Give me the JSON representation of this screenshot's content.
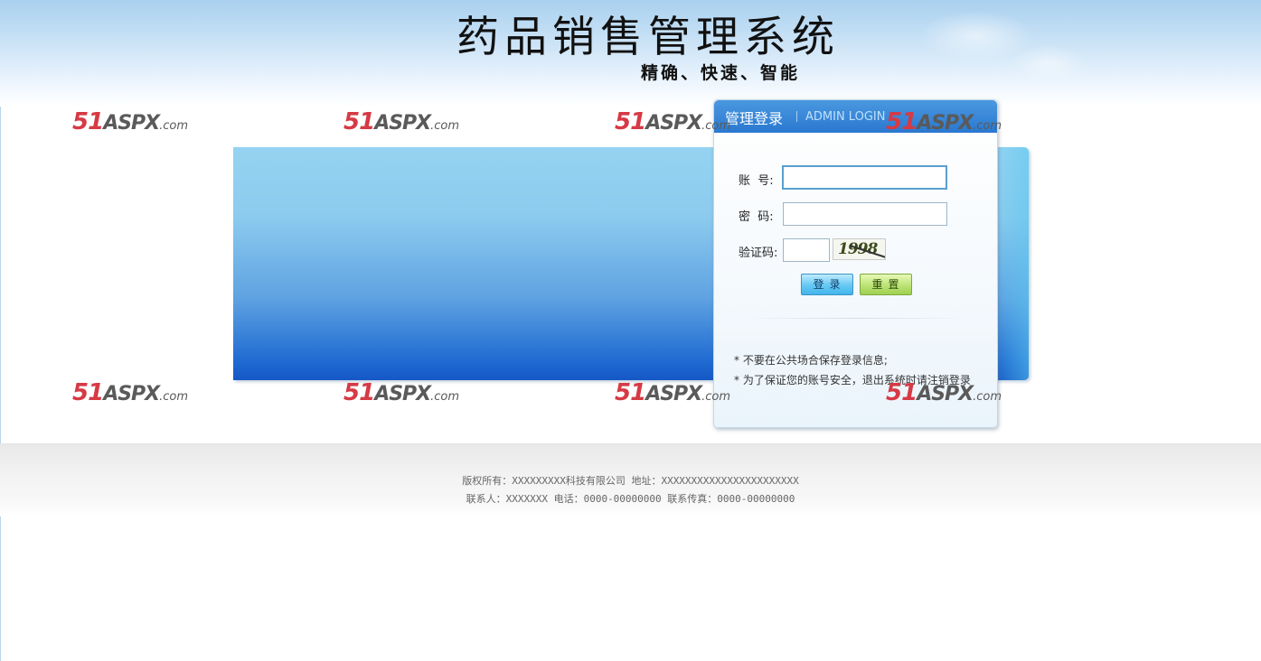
{
  "header": {
    "title": "药品销售管理系统",
    "subtitle": "精确、快速、智能"
  },
  "watermark": {
    "brand_number": "51",
    "brand_name": "ASPX",
    "brand_suffix": ".com"
  },
  "login": {
    "title": "管理登录",
    "subtitle": "ADMIN LOGIN",
    "account_label": "账  号:",
    "account_value": "",
    "password_label": "密  码:",
    "password_value": "",
    "captcha_label": "验证码:",
    "captcha_value": "",
    "captcha_image_text": "1998",
    "login_button": "登录",
    "reset_button": "重置",
    "notes": [
      "* 不要在公共场合保存登录信息;",
      "* 为了保证您的账号安全，退出系统时请注销登录"
    ]
  },
  "footer": {
    "line1": "版权所有：XXXXXXXXX科技有限公司 地址：XXXXXXXXXXXXXXXXXXXXXXX",
    "line2": "联系人：XXXXXXX 电话：0000-00000000 联系传真：0000-00000000"
  },
  "colors": {
    "header_bg": "#a9d0ef",
    "banner_top": "#95d3f1",
    "banner_bottom": "#1558c6",
    "login_header": "#2a78d0",
    "login_button": "#41b5ec",
    "reset_button": "#9fd050",
    "watermark_red": "#d63a45"
  }
}
